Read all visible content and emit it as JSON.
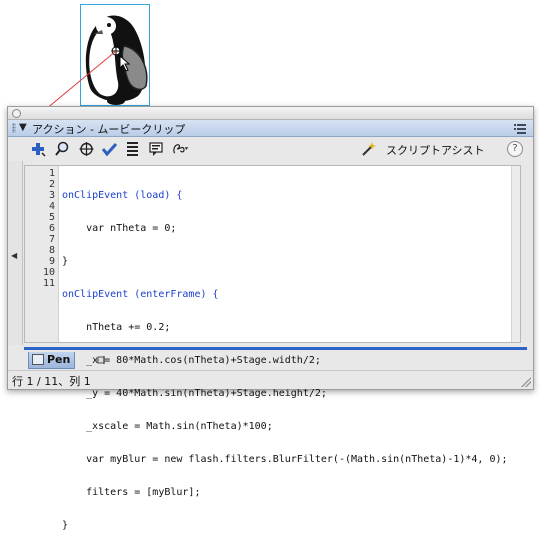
{
  "panel": {
    "title": "アクション - ムービークリップ",
    "title_arrow": "▼"
  },
  "toolbar": {
    "icons": [
      "add-statement-icon",
      "find-icon",
      "target-path-icon",
      "check-syntax-icon",
      "auto-format-icon",
      "code-hint-icon",
      "debug-options-icon"
    ],
    "script_assist_label": "スクリプトアシスト",
    "help_label": "?"
  },
  "editor": {
    "line_numbers": [
      "1",
      "2",
      "3",
      "4",
      "5",
      "6",
      "7",
      "8",
      "9",
      "10",
      "11"
    ],
    "lines": [
      "onClipEvent (load) {",
      "    var nTheta = 0;",
      "}",
      "onClipEvent (enterFrame) {",
      "    nTheta += 0.2;",
      "    _x = 80*Math.cos(nTheta)+Stage.width/2;",
      "    _y = 40*Math.sin(nTheta)+Stage.height/2;",
      "    _xscale = Math.sin(nTheta)*100;",
      "    var myBlur = new flash.filters.BlurFilter(-(Math.sin(nTheta)-1)*4, 0);",
      "    filters = [myBlur];",
      "}"
    ]
  },
  "tabs": {
    "active_label": "Pen"
  },
  "status": {
    "text": "行 1 / 11、列 1"
  },
  "colors": {
    "keyword": "#1a3fcf",
    "tab_accent": "#2c63c9",
    "selection_box": "#33a6e0",
    "pointer_line": "#e03c3c"
  }
}
